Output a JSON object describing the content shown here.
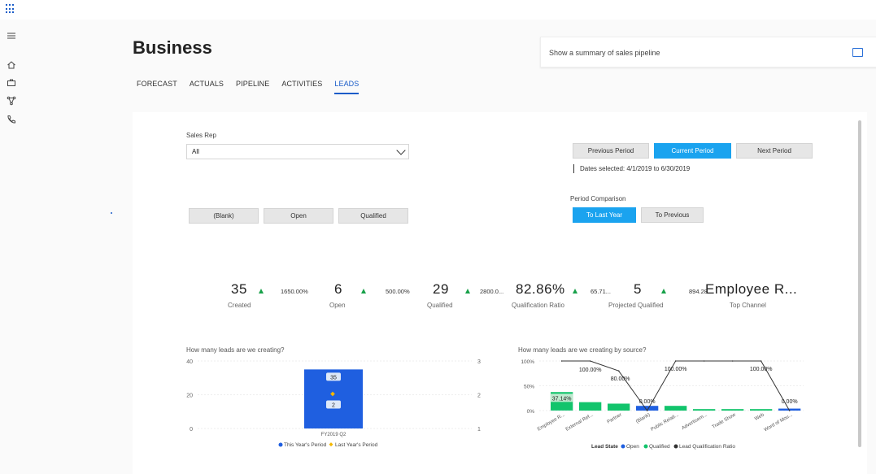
{
  "header": {
    "title": "Business"
  },
  "tabs": [
    {
      "label": "FORECAST"
    },
    {
      "label": "ACTUALS"
    },
    {
      "label": "PIPELINE"
    },
    {
      "label": "ACTIVITIES"
    },
    {
      "label": "LEADS"
    }
  ],
  "copilot": {
    "placeholder": "Show a summary of sales pipeline"
  },
  "filters": {
    "sales_rep_label": "Sales Rep",
    "sales_rep_value": "All",
    "status_buttons": [
      "(Blank)",
      "Open",
      "Qualified"
    ],
    "period_buttons": [
      "Previous Period",
      "Current Period",
      "Next Period"
    ],
    "dates_selected": "Dates selected: 4/1/2019 to 6/30/2019",
    "period_comparison_label": "Period Comparison",
    "comparison_buttons": [
      "To Last Year",
      "To Previous"
    ]
  },
  "kpis": [
    {
      "value": "35",
      "label": "Created",
      "change": "1650.00%"
    },
    {
      "value": "6",
      "label": "Open",
      "change": "500.00%"
    },
    {
      "value": "29",
      "label": "Qualified",
      "change": "2800.0..."
    },
    {
      "value": "82.86%",
      "label": "Qualification Ratio",
      "change": "65.71..."
    },
    {
      "value": "5",
      "label": "Projected Qualified",
      "change": "894.28..."
    },
    {
      "value": "Employee R...",
      "label": "Top Channel"
    }
  ],
  "colors": {
    "accent": "#1aa3ef",
    "brand": "#1a5cc8",
    "open": "#1f5fe0",
    "qualified": "#12c46c",
    "ratio": "#333333",
    "last_year": "#f5b800",
    "up": "#18a14a"
  },
  "chart_data": [
    {
      "type": "bar",
      "title": "How many leads are we creating?",
      "categories": [
        "FY2019 Q2"
      ],
      "series": [
        {
          "name": "This Year's Period",
          "values": [
            35
          ],
          "labels": [
            "35"
          ],
          "axis": "left"
        },
        {
          "name": "Last Year's Period",
          "values": [
            2
          ],
          "labels": [
            "2"
          ],
          "axis": "right"
        }
      ],
      "y_ticks": [
        "0",
        "20",
        "40"
      ],
      "y2_ticks": [
        "1",
        "2",
        "3"
      ],
      "ylim": [
        0,
        40
      ],
      "y2lim": [
        1,
        3
      ],
      "legend_position": "bottom"
    },
    {
      "type": "bar",
      "title": "How many leads are we creating by source?",
      "categories": [
        "Employee R...",
        "External Ref...",
        "Partner",
        "(Blank)",
        "Public Relati...",
        "Advertisem...",
        "Trade Show",
        "Web",
        "Word of Mou..."
      ],
      "series": [
        {
          "name": "Open",
          "values": [
            0.2,
            0,
            0,
            9.5,
            0,
            0,
            0,
            0,
            4
          ]
        },
        {
          "name": "Qualified",
          "values": [
            37.14,
            17,
            14,
            0,
            9.5,
            3,
            3,
            3,
            0
          ]
        },
        {
          "name": "Lead Qualification Ratio",
          "values": [
            100,
            100,
            80,
            0,
            100,
            100,
            100,
            100,
            0
          ]
        }
      ],
      "data_labels": [
        "37.14%",
        "100.00%",
        "80.00%",
        "0.00%",
        "100.00%",
        "100.00%",
        "0.00%"
      ],
      "y_ticks": [
        "0%",
        "50%",
        "100%"
      ],
      "ylim": [
        0,
        100
      ],
      "legend_title": "Lead State",
      "legend_position": "bottom"
    }
  ]
}
